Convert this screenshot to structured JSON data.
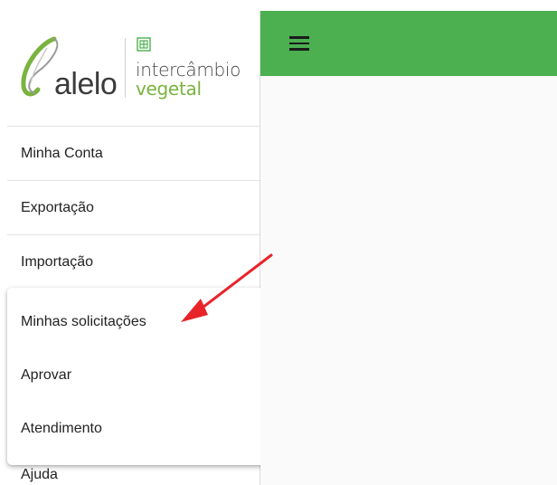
{
  "logo": {
    "brand": "alelo",
    "product_line1": "intercâmbio",
    "product_line2": "vegetal",
    "brand_color": "#7ab33f"
  },
  "sidebar": {
    "items": [
      {
        "label": "Minha Conta"
      },
      {
        "label": "Exportação"
      },
      {
        "label": "Importação"
      }
    ],
    "submenu": [
      {
        "label": "Minhas solicitações"
      },
      {
        "label": "Aprovar"
      },
      {
        "label": "Atendimento"
      }
    ],
    "last_item": {
      "label": "Ajuda"
    }
  },
  "topbar": {
    "color": "#4caf50",
    "menu_icon": "hamburger-menu-icon"
  },
  "annotation": {
    "arrow_color": "#e8242a",
    "points_to": "Minhas solicitações"
  }
}
